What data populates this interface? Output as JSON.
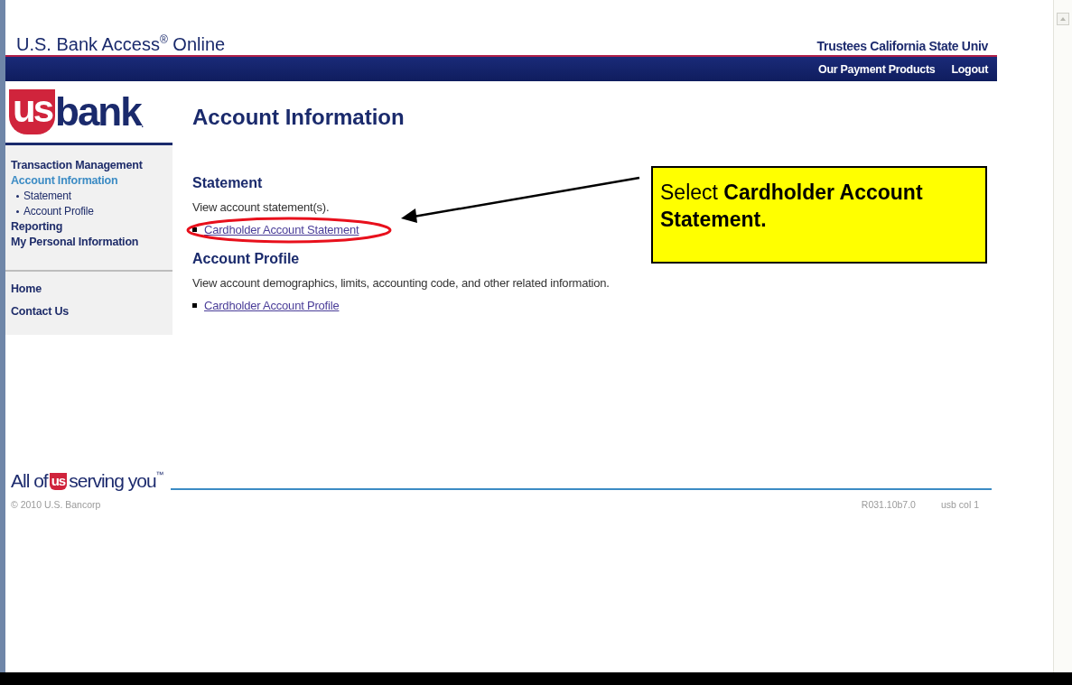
{
  "header": {
    "title": "U.S. Bank Access",
    "title_mark": "®",
    "title_end": " Online",
    "org": "Trustees California State Univ",
    "nav_links": [
      "Our Payment Products",
      "Logout"
    ]
  },
  "logo": {
    "mark": "us",
    "word": "bank",
    "dot": "."
  },
  "sidebar": {
    "groups": [
      {
        "items": [
          {
            "label": "Transaction Management",
            "kind": "section",
            "selected": false
          },
          {
            "label": "Account Information",
            "kind": "section",
            "selected": true
          },
          {
            "label": "Statement",
            "kind": "sub",
            "selected": false
          },
          {
            "label": "Account Profile",
            "kind": "sub",
            "selected": false
          },
          {
            "label": "Reporting",
            "kind": "section",
            "selected": false
          },
          {
            "label": "My Personal Information",
            "kind": "section",
            "selected": false
          }
        ]
      },
      {
        "items": [
          {
            "label": "Home",
            "kind": "section",
            "selected": false
          },
          {
            "label": "Contact Us",
            "kind": "section",
            "selected": false
          }
        ]
      }
    ]
  },
  "main": {
    "title": "Account Information",
    "sections": [
      {
        "heading": "Statement",
        "description": "View account statement(s).",
        "links": [
          "Cardholder Account Statement"
        ],
        "circled": true
      },
      {
        "heading": "Account Profile",
        "description": "View account demographics, limits, accounting code, and other related information.",
        "links": [
          "Cardholder Account Profile"
        ]
      }
    ]
  },
  "callout": {
    "text": "Select **Cardholder Account Statement.**"
  },
  "footer": {
    "tagline_start": "All of",
    "tagline_mark": "us",
    "tagline_end": "serving you",
    "tagline_tm": "™",
    "copyright": "© 2010 U.S. Bancorp",
    "version": "R031.10b7.0",
    "column": "usb col 1"
  }
}
